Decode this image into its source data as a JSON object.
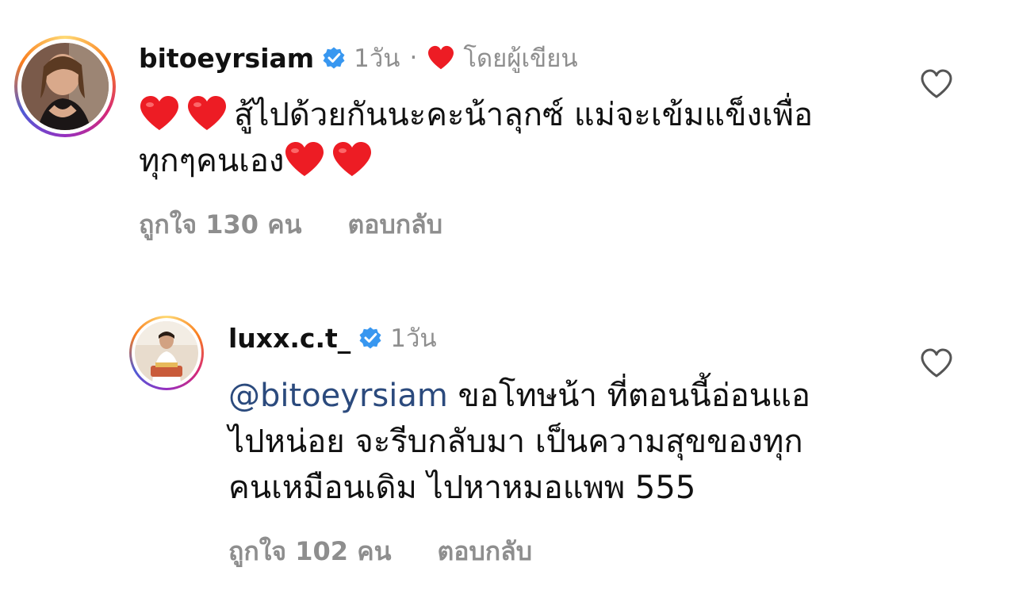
{
  "comments": [
    {
      "username": "bitoeyrsiam",
      "time": "1วัน",
      "separator": "·",
      "by_author_label": "โดยผู้เขียน",
      "text_line1": "สู้ไปด้วยกันนะคะน้าลุกซ์ แม่จะเข้มแข็งเพื่อ",
      "text_line2": "ทุกๆคนเอง",
      "likes_label": "ถูกใจ 130 คน",
      "reply_label": "ตอบกลับ"
    },
    {
      "username": "luxx.c.t_",
      "time": "1วัน",
      "mention": "@bitoeyrsiam",
      "text_line1_rest": " ขอโทษน้า ที่ตอนนี้อ่อนแอ",
      "text_line2": "ไปหน่อย จะรีบกลับมา เป็นความสุขของทุก",
      "text_line3": "คนเหมือนเดิม ไปหาหมอแพพ 555",
      "likes_label": "ถูกใจ 102 คน",
      "reply_label": "ตอบกลับ"
    }
  ],
  "colors": {
    "verified_badge": "#3897f0",
    "heart_red": "#ed1c24",
    "muted_text": "#8e8e8e",
    "mention_link": "#2b4a7d"
  },
  "icons": [
    "verified-badge-icon",
    "heart-emoji-icon",
    "heart-outline-icon"
  ]
}
